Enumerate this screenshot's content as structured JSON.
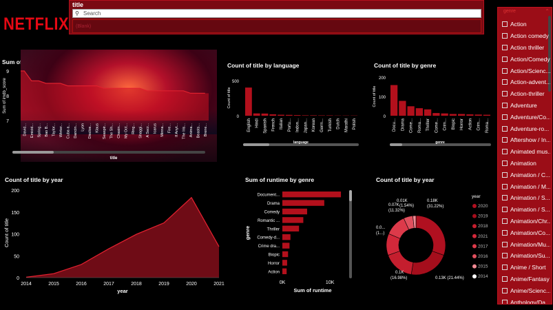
{
  "brand": {
    "logo_text": "NETFLIX",
    "color": "#e50914"
  },
  "title_slicer": {
    "title": "title",
    "search_placeholder": "Search",
    "faint_item": "(Blank)"
  },
  "genre_slicer": {
    "header": "genre",
    "items": [
      "Action",
      "Action comedy",
      "Action thriller",
      "Action/Comedy",
      "Action/Scienc...",
      "Action-advent...",
      "Action-thriller",
      "Adventure",
      "Adventure/Co...",
      "Adventure-ro...",
      "Aftershow / In...",
      "Animated mus...",
      "Animation",
      "Animation / C...",
      "Animation / M...",
      "Animation / S...",
      "Animation / S...",
      "Animation/Chr...",
      "Animation/Co...",
      "Animation/Mu...",
      "Animation/Su...",
      "Anime / Short",
      "Anime/Fantasy",
      "Anime/Scienc...",
      "Anthology/Da..."
    ]
  },
  "chart_data": [
    {
      "id": "imdb",
      "type": "area",
      "title": "Sum of imdb_score by title",
      "xlabel": "title",
      "ylabel": "Sum of imdb_score",
      "ylim": [
        7,
        9
      ],
      "yticks": [
        9,
        8,
        7
      ],
      "categories": [
        "David...",
        "Emicid...",
        "Spring...",
        "Bao B...",
        "Taylor...",
        "Winter...",
        "Cuba a...",
        "Dancin...",
        "Lyon",
        "Disclos...",
        "Klaus",
        "Seaspir...",
        "The Sh...",
        "Chasin...",
        "My Oct...",
        "Ring...",
        "Shaggi...",
        "A Secr...",
        "Icarus",
        "Minna...",
        "Fire...",
        "If Anyt...",
        "The Iris...",
        "Anima...",
        "Beasts...",
        "Brene..."
      ],
      "values": [
        9.0,
        8.6,
        8.6,
        8.5,
        8.5,
        8.5,
        8.4,
        8.4,
        8.4,
        8.4,
        8.4,
        8.3,
        8.3,
        8.3,
        8.3,
        8.3,
        8.3,
        8.2,
        8.2,
        8.2,
        8.2,
        8.2,
        8.2,
        8.1,
        8.1,
        8.1
      ]
    },
    {
      "id": "language",
      "type": "bar",
      "title": "Count of title by language",
      "xlabel": "language",
      "ylabel": "Count of title",
      "ylim": [
        0,
        500
      ],
      "yticks": [
        500,
        0
      ],
      "categories": [
        "English",
        "Hindi",
        "Spanish",
        "French",
        "Italian",
        "Portu...",
        "Indon...",
        "Japan...",
        "Korean",
        "Germ...",
        "Turkish",
        "Dutch",
        "Marathi",
        "Polish"
      ],
      "values": [
        401,
        33,
        31,
        20,
        14,
        12,
        9,
        6,
        6,
        5,
        5,
        3,
        3,
        3
      ]
    },
    {
      "id": "genre",
      "type": "bar",
      "title": "Count of title by genre",
      "xlabel": "genre",
      "ylabel": "Count of title",
      "ylim": [
        0,
        200
      ],
      "yticks": [
        200,
        100,
        0
      ],
      "categories": [
        "Docu...",
        "Drama",
        "Come...",
        "Roma...",
        "Thriller",
        "Come...",
        "Crim...",
        "Biopic",
        "Horror",
        "Action",
        "Crim...",
        "Roma..."
      ],
      "values": [
        159,
        77,
        49,
        39,
        33,
        14,
        12,
        9,
        9,
        7,
        6,
        5
      ]
    },
    {
      "id": "year",
      "type": "area",
      "title": "Count of title by year",
      "xlabel": "year",
      "ylabel": "Count of title",
      "ylim": [
        0,
        200
      ],
      "yticks": [
        200,
        150,
        100,
        50,
        0
      ],
      "categories": [
        "2014",
        "2015",
        "2016",
        "2017",
        "2018",
        "2019",
        "2020",
        "2021"
      ],
      "values": [
        1,
        9,
        30,
        66,
        99,
        125,
        183,
        71
      ]
    },
    {
      "id": "runtime",
      "type": "bar",
      "title": "Sum of runtime by genre",
      "xlabel": "Sum of runtime",
      "ylabel": "genre",
      "xlim": [
        0,
        12000
      ],
      "xticks": [
        "0K",
        "10K"
      ],
      "categories": [
        "Document...",
        "Drama",
        "Comedy",
        "Romantic ...",
        "Thriller",
        "Comedy-d...",
        "Crime dra...",
        "Biopic",
        "Horror",
        "Action"
      ],
      "values": [
        12300,
        8800,
        5200,
        4400,
        3500,
        1700,
        1500,
        1200,
        1000,
        900
      ]
    },
    {
      "id": "donut",
      "type": "pie",
      "title": "Count of title by year",
      "legend_title": "year",
      "series": [
        {
          "name": "2020",
          "value": 0.18,
          "label": "0.18K (31.22%)",
          "color": "#b01020"
        },
        {
          "name": "2019",
          "value": 0.13,
          "label": "0.13K (21.44%)",
          "color": "#a50e1c"
        },
        {
          "name": "2018",
          "value": 0.1,
          "label": "0.1K (16.98%)",
          "color": "#c41e2e"
        },
        {
          "name": "2021",
          "value": 0.07,
          "label": "",
          "color": "#d2283a"
        },
        {
          "name": "2017",
          "value": 0.07,
          "label": "0.07K (11.32%)",
          "color": "#dc3a4a"
        },
        {
          "name": "2016",
          "value": 0.03,
          "label": "0.0... (1...)",
          "color": "#e0505e"
        },
        {
          "name": "2015",
          "value": 0.01,
          "label": "0.01K (1.54%)",
          "color": "#f08a94"
        },
        {
          "name": "2014",
          "value": 0.0,
          "label": "",
          "color": "#ffffff"
        }
      ],
      "legend_order": [
        "2020",
        "2019",
        "2018",
        "2021",
        "2017",
        "2016",
        "2015",
        "2014"
      ]
    }
  ]
}
